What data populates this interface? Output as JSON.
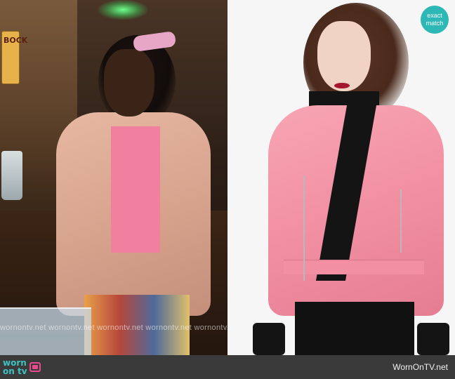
{
  "left_panel": {
    "beer_tap_label": "BOCK",
    "watermark": "wornontv.net  wornontv.net  wornontv.net  wornontv.net  wornontv.net  wornontv.net"
  },
  "match_badge": {
    "line1": "exact",
    "line2": "match",
    "color": "#2db8b6"
  },
  "footer": {
    "logo_text": "worn\non tv",
    "logo_icon": "tv-icon",
    "site": "WornOnTV.net",
    "background": "#3a3a3a",
    "logo_color": "#3ec3c1",
    "tv_color": "#e74a8b"
  }
}
